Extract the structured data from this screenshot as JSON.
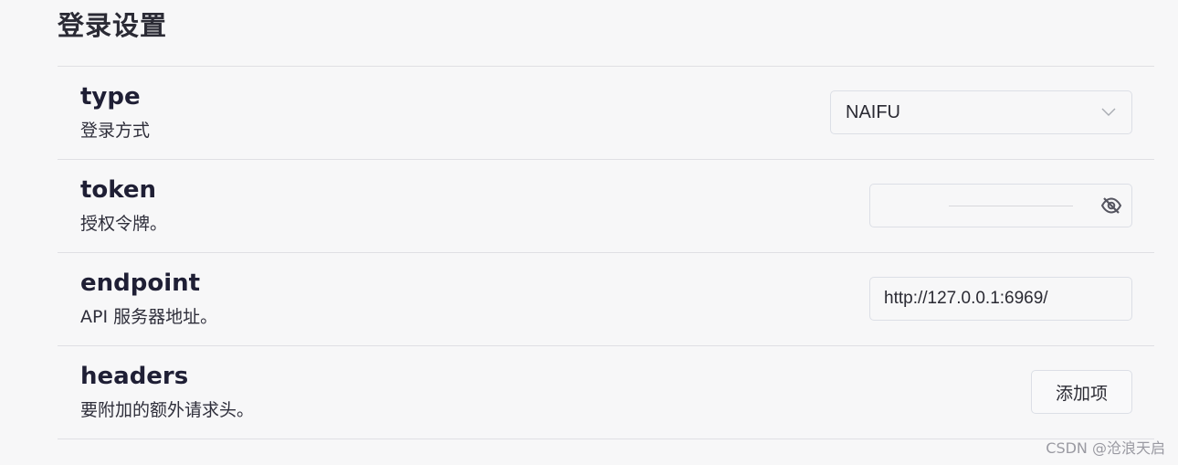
{
  "section": {
    "title": "登录设置"
  },
  "settings": [
    {
      "name": "type",
      "description": "登录方式",
      "control": "select",
      "value": "NAIFU",
      "icon": "chevron-down-icon"
    },
    {
      "name": "token",
      "description": "授权令牌。",
      "control": "password",
      "value": "",
      "icon": "eye-off-icon"
    },
    {
      "name": "endpoint",
      "description": "API 服务器地址。",
      "control": "text",
      "value": "http://127.0.0.1:6969/"
    },
    {
      "name": "headers",
      "description": "要附加的额外请求头。",
      "control": "button",
      "button_label": "添加项"
    }
  ],
  "watermark": "CSDN @沧浪天启",
  "colors": {
    "background": "#f7f7f8",
    "border": "#dcdfe6",
    "divider": "#e0e0e4",
    "text": "#1f1f35",
    "icon": "#555560"
  }
}
